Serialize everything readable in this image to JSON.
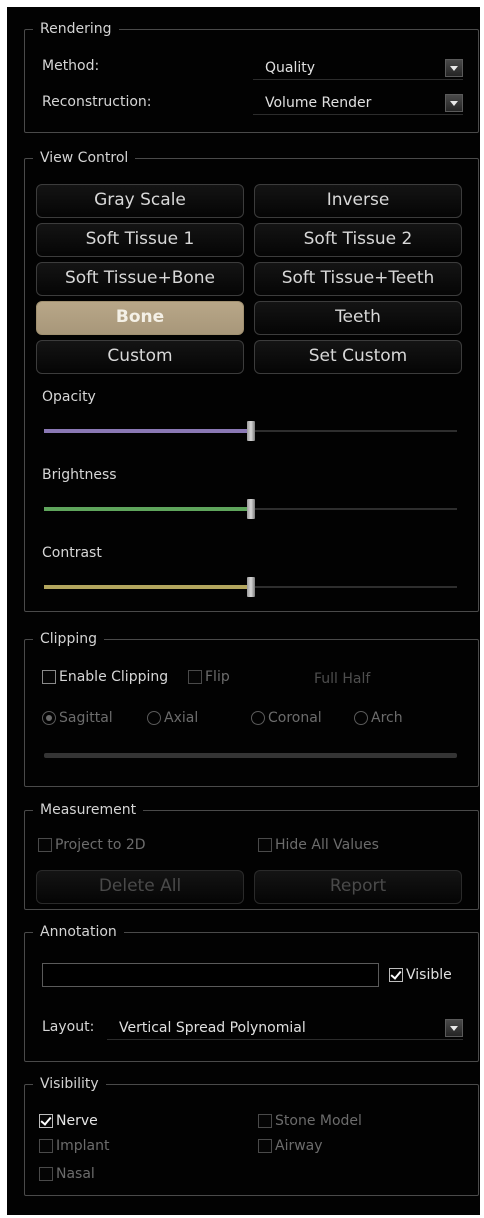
{
  "rendering": {
    "title": "Rendering",
    "method_label": "Method:",
    "method_value": "Quality",
    "reconstruction_label": "Reconstruction:",
    "reconstruction_value": "Volume Render"
  },
  "view_control": {
    "title": "View Control",
    "presets": [
      "Gray Scale",
      "Inverse",
      "Soft Tissue 1",
      "Soft Tissue 2",
      "Soft Tissue+Bone",
      "Soft Tissue+Teeth",
      "Bone",
      "Teeth",
      "Custom",
      "Set Custom"
    ],
    "active_preset": "Bone",
    "opacity_label": "Opacity",
    "brightness_label": "Brightness",
    "contrast_label": "Contrast",
    "opacity_value": 0.5,
    "brightness_value": 0.5,
    "contrast_value": 0.5,
    "colors": {
      "opacity": "#8a78b4",
      "brightness": "#5fa55c",
      "contrast": "#b3a65e",
      "active": "#a8977a"
    }
  },
  "clipping": {
    "title": "Clipping",
    "enable_label": "Enable Clipping",
    "flip_label": "Flip",
    "full_half_label": "Full Half",
    "planes": [
      "Sagittal",
      "Axial",
      "Coronal",
      "Arch"
    ],
    "selected_plane": "Sagittal"
  },
  "measurement": {
    "title": "Measurement",
    "project_label": "Project to 2D",
    "hide_values_label": "Hide All Values",
    "delete_all_label": "Delete All",
    "report_label": "Report"
  },
  "annotation": {
    "title": "Annotation",
    "text_value": "",
    "visible_label": "Visible",
    "visible_checked": true,
    "layout_label": "Layout:",
    "layout_value": "Vertical Spread Polynomial"
  },
  "visibility": {
    "title": "Visibility",
    "nerve_label": "Nerve",
    "nerve_checked": true,
    "stone_model_label": "Stone Model",
    "implant_label": "Implant",
    "airway_label": "Airway",
    "nasal_label": "Nasal"
  }
}
